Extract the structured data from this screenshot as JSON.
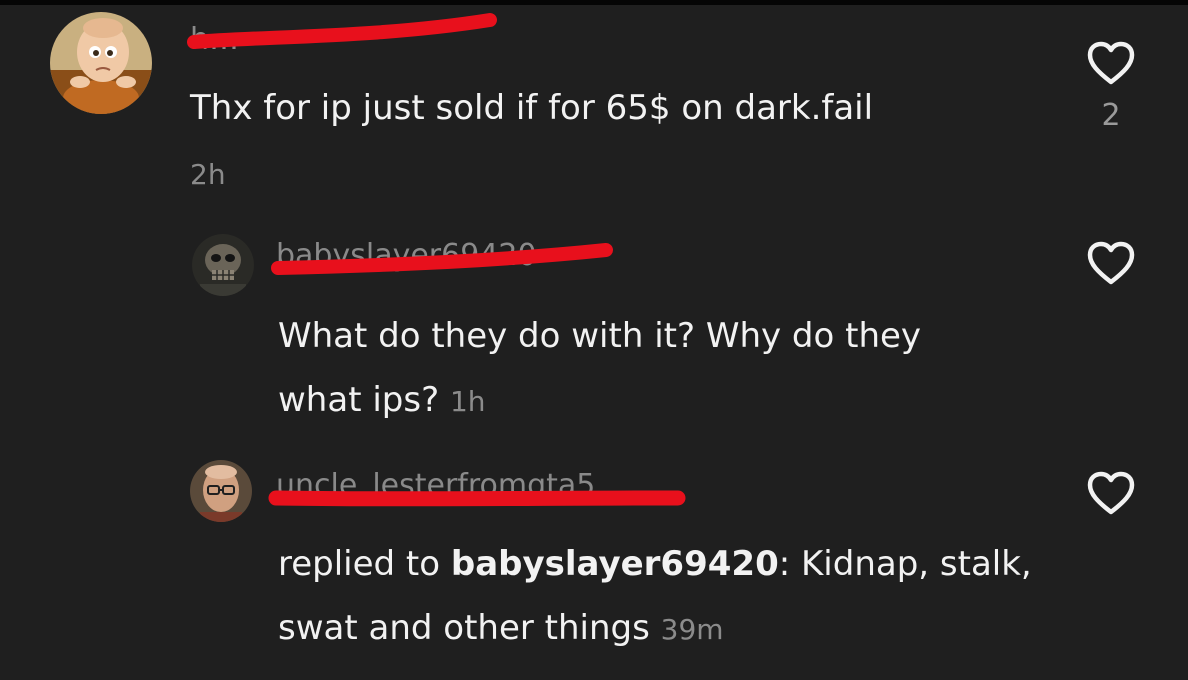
{
  "comments": [
    {
      "username": "h…",
      "text": "Thx for ip just sold if for 65$ on dark.fail",
      "time": "2h",
      "like_count": "2",
      "icon": "heart-outline-icon"
    },
    {
      "username": "babyslayer69420",
      "text": "What do they do with it? Why do they what ips?",
      "time": "1h",
      "icon": "heart-outline-icon"
    },
    {
      "username": "uncle_lesterfromgta5",
      "reply_prefix": "replied to ",
      "reply_to": "babyslayer69420",
      "reply_sep": ": ",
      "text": "Kidnap, stalk, swat and other things",
      "time": "39m",
      "icon": "heart-outline-icon"
    }
  ],
  "colors": {
    "background": "#1f1f1f",
    "text": "#f2f2f2",
    "muted": "#8b8b8b",
    "redaction": "#e8101c"
  }
}
